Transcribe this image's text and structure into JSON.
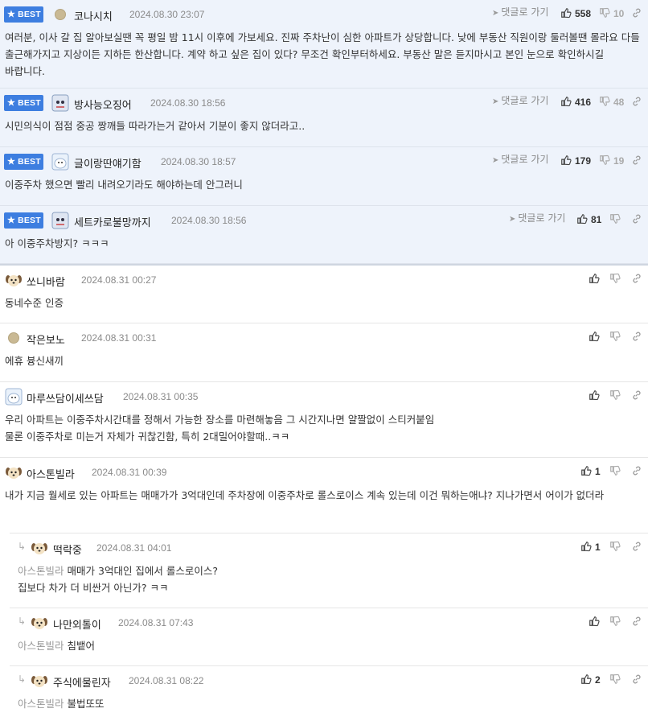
{
  "labels": {
    "best": "BEST",
    "goto": "댓글로 가기"
  },
  "best_comments": [
    {
      "nick": "코나시치",
      "date": "2024.08.30 23:07",
      "avatar": "beige-dot-avatar",
      "up": "558",
      "down": "10",
      "text": "여러분, 이사 갈 집 알아보실땐 꼭 평일 밤 11시 이후에 가보세요. 진짜 주차난이 심한 아파트가 상당합니다. 낮에 부동산 직원이랑 둘러볼땐 몰라요 다들 출근해가지고 지상이든 지하든 한산합니다. 계약 하고 싶은 집이 있다? 무조건 확인부터하세요. 부동산 말은 듣지마시고 본인 눈으로 확인하시길 바랍니다."
    },
    {
      "nick": "방사능오징어",
      "date": "2024.08.30 18:56",
      "avatar": "robot-avatar",
      "up": "416",
      "down": "48",
      "text": "시민의식이 점점 중공 짱깨들 따라가는거 같아서 기분이 좋지 않더라고.."
    },
    {
      "nick": "글이랑딴얘기함",
      "date": "2024.08.30 18:57",
      "avatar": "seal-avatar",
      "up": "179",
      "down": "19",
      "text": "이중주차 했으면 빨리 내려오기라도 해야하는데 안그러니"
    },
    {
      "nick": "세트카로불망까지",
      "date": "2024.08.30 18:56",
      "avatar": "robot-avatar",
      "up": "81",
      "down": "",
      "text": "아 이중주차방지? ㅋㅋㅋ"
    }
  ],
  "comments": [
    {
      "nick": "쏘니바람",
      "date": "2024.08.31 00:27",
      "avatar": "puppy-avatar",
      "up": "",
      "text": "동네수준 인증"
    },
    {
      "nick": "작은보노",
      "date": "2024.08.31 00:31",
      "avatar": "beige-dot-avatar",
      "up": "",
      "text": "에휴 븅신새끼"
    },
    {
      "nick": "마루쓰담이세쓰담",
      "date": "2024.08.31 00:35",
      "avatar": "seal-avatar",
      "up": "",
      "text": "우리 아파트는 이중주차시간대를 정해서 가능한 장소를 마련해놓음 그 시간지나면 얄짤없이 스티커붙임\n물론 이중주차로 미는거 자체가 귀찮긴함, 특히 2대밀어야할때..ㅋㅋ"
    },
    {
      "nick": "아스톤빌라",
      "date": "2024.08.31 00:39",
      "avatar": "puppy-avatar",
      "up": "1",
      "text": "내가 지금 월세로 있는 아파트는 매매가가 3억대인데 주차장에 이중주차로 롤스로이스 계속 있는데 이건 뭐하는애냐? 지나가면서 어이가 없더라"
    }
  ],
  "replies": [
    {
      "nick": "떡락중",
      "date": "2024.08.31 04:01",
      "avatar": "puppy-avatar",
      "up": "1",
      "mention": "아스톤빌라",
      "text": "매매가 3억대인 집에서 롤스로이스?\n집보다 차가 더 비싼거 아닌가? ㅋㅋ"
    },
    {
      "nick": "나만외톨이",
      "date": "2024.08.31 07:43",
      "avatar": "puppy-avatar",
      "up": "",
      "mention": "아스톤빌라",
      "text": "침뱉어"
    },
    {
      "nick": "주식에물린자",
      "date": "2024.08.31 08:22",
      "avatar": "puppy-avatar",
      "up": "2",
      "mention": "아스톤빌라",
      "text": "불법또또"
    }
  ],
  "colors": {
    "best_bg": "#eef3fb",
    "badge": "#3d7ee0",
    "date": "#8a8a8a",
    "mention": "#999999"
  }
}
